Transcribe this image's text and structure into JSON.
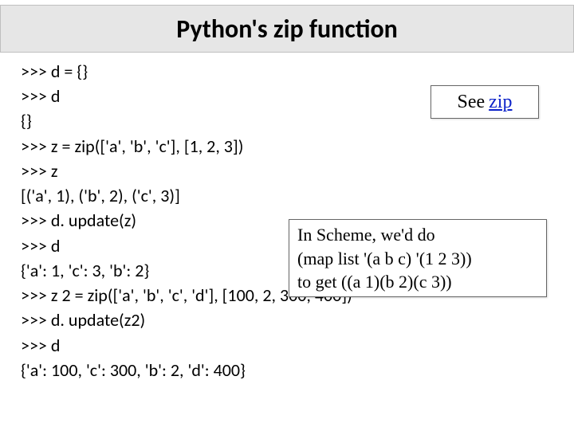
{
  "title": "Python's zip function",
  "code_lines": [
    ">>> d = {}",
    ">>> d",
    "{}",
    ">>> z = zip(['a', 'b', 'c'], [1, 2, 3])",
    ">>> z",
    "[('a', 1), ('b', 2), ('c', 3)]",
    ">>> d. update(z)",
    ">>> d",
    "{'a': 1, 'c': 3, 'b': 2}",
    ">>> z 2 = zip(['a', 'b', 'c', 'd'], [100, 2, 300, 400])",
    ">>> d. update(z2)",
    ">>> d",
    "{'a': 100, 'c': 300, 'b': 2, 'd': 400}"
  ],
  "see_zip": {
    "prefix": "See ",
    "link_text": "zip"
  },
  "scheme_box": {
    "line1": "In Scheme, we'd do",
    "line2": "(map list '(a b c) '(1 2 3))",
    "line3": "to get ((a 1)(b 2)(c 3))"
  }
}
